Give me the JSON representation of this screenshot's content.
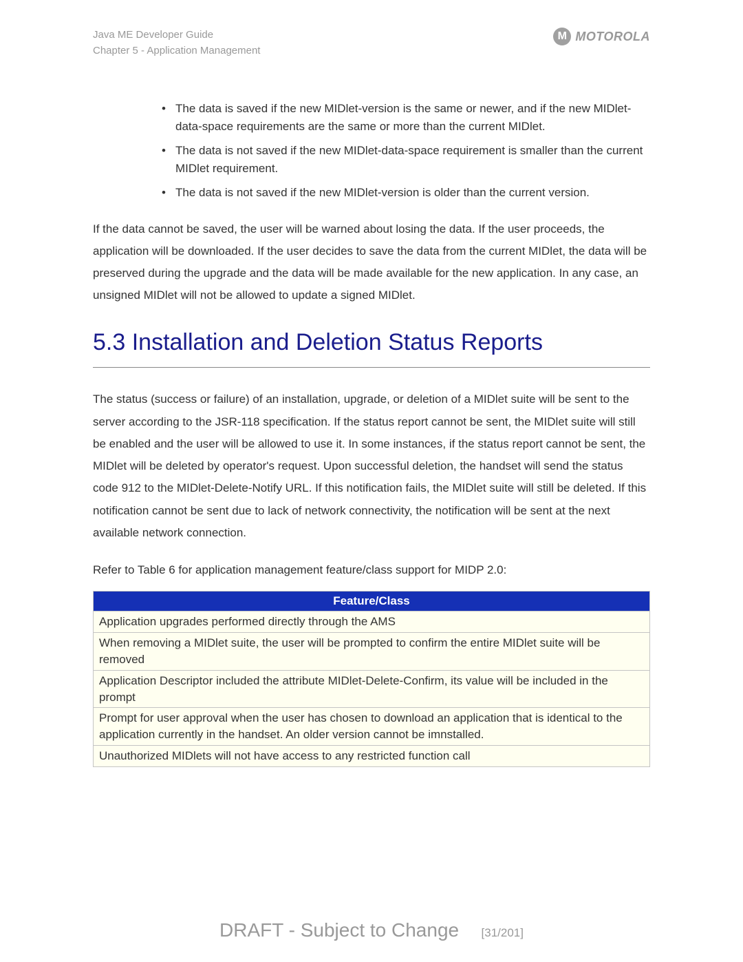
{
  "header": {
    "line1": "Java ME Developer Guide",
    "line2": "Chapter 5 - Application Management",
    "logo_text": "MOTOROLA",
    "logo_mark": "M"
  },
  "bullets": [
    "The data is saved if the new MIDlet-version is the same or newer, and if the new MIDlet-data-space requirements are the same or more than the current MIDlet.",
    "The data is not saved if the new MIDlet-data-space requirement is smaller than the current MIDlet requirement.",
    "The data is not saved if the new MIDlet-version is older than the current version."
  ],
  "paragraph1": "If the data cannot be saved, the user will be warned about losing the data. If the user proceeds, the application will be downloaded. If the user decides to save the data from the current MIDlet, the data will be preserved during the upgrade and the data will be made available for the new application. In any case, an unsigned MIDlet will not be allowed to update a signed MIDlet.",
  "heading": "5.3 Installation and Deletion Status Reports",
  "paragraph2": "The status (success or failure) of an installation, upgrade, or deletion of a MIDlet suite will be sent to the server according to the JSR-118 specification. If the status report cannot be sent, the MIDlet suite will still be enabled and the user will be allowed to use it. In some instances, if the status report cannot be sent, the MIDlet will be deleted by operator's request. Upon successful deletion, the handset will send the status code 912 to the MIDlet-Delete-Notify URL. If this notification fails, the MIDlet suite will still be deleted. If this notification cannot be sent due to lack of network connectivity, the notification will be sent at the next available network connection.",
  "ref_text": "Refer to Table 6 for application management feature/class support for MIDP 2.0:",
  "table": {
    "header": "Feature/Class",
    "rows": [
      "Application upgrades performed directly through the AMS",
      "When removing a MIDlet suite, the user will be prompted to confirm the entire MIDlet suite will be removed",
      "Application Descriptor included the attribute MIDlet-Delete-Confirm, its value will be included in the prompt",
      "Prompt for user approval when the user has chosen to download an application that is identical to the application currently in the handset. An older version cannot be imnstalled.",
      "Unauthorized MIDlets will not have access to any restricted function call"
    ]
  },
  "footer": {
    "draft": "DRAFT - Subject to Change",
    "page": "[31/201]"
  }
}
